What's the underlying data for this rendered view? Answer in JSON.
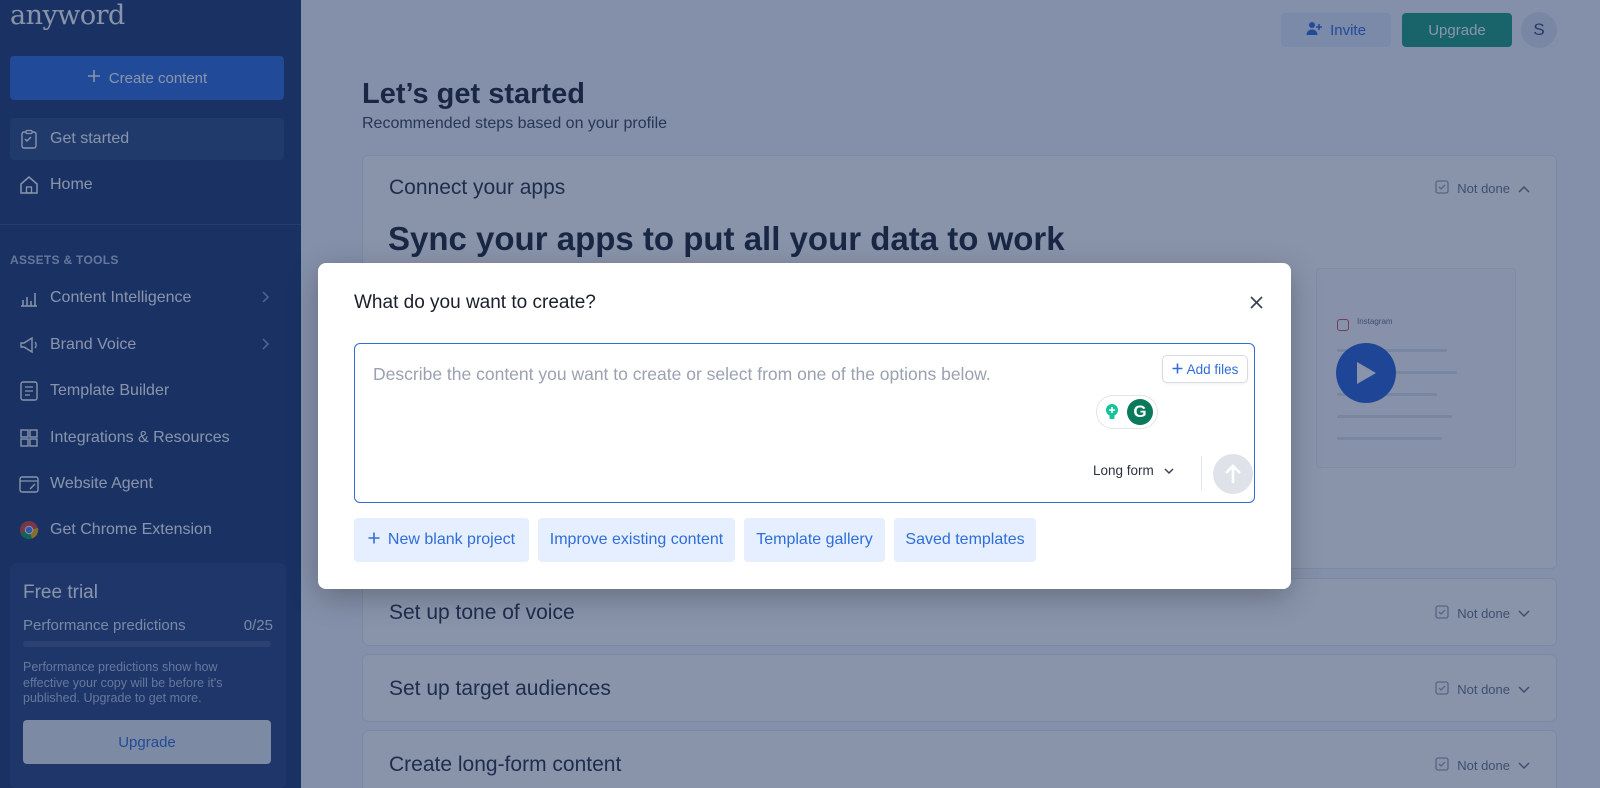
{
  "app": {
    "logo": "anyword"
  },
  "sidebar": {
    "create_label": "Create content",
    "items": [
      {
        "label": "Get started",
        "icon": "clipboard-icon"
      },
      {
        "label": "Home",
        "icon": "home-icon"
      }
    ],
    "section_title": "ASSETS & TOOLS",
    "tools": [
      {
        "label": "Content Intelligence",
        "icon": "chart-icon"
      },
      {
        "label": "Brand Voice",
        "icon": "megaphone-icon"
      },
      {
        "label": "Template Builder",
        "icon": "template-icon"
      },
      {
        "label": "Integrations & Resources",
        "icon": "grid-icon"
      },
      {
        "label": "Website Agent",
        "icon": "browser-icon"
      },
      {
        "label": "Get Chrome Extension",
        "icon": "chrome-icon"
      }
    ],
    "trial": {
      "title": "Free trial",
      "metric_label": "Performance predictions",
      "metric_value": "0/25",
      "progress": 0,
      "description": "Performance predictions show how effective your copy will be before it's published. Upgrade to get more.",
      "upgrade_label": "Upgrade"
    }
  },
  "header": {
    "invite_label": "Invite",
    "upgrade_label": "Upgrade",
    "avatar_initial": "S"
  },
  "main": {
    "title": "Let’s get started",
    "subtitle": "Recommended steps based on your profile",
    "sections": [
      {
        "title": "Connect your apps",
        "status": "Not done",
        "expanded": true
      },
      {
        "title": "Set up tone of voice",
        "status": "Not done"
      },
      {
        "title": "Set up target audiences",
        "status": "Not done"
      },
      {
        "title": "Create long-form content",
        "status": "Not done"
      }
    ],
    "hero_heading": "Sync your apps to put all your data to work",
    "preview_label": "Instagram"
  },
  "modal": {
    "title": "What do you want to create?",
    "placeholder": "Describe the content you want to create or select from one of the options below.",
    "add_files_label": "Add files",
    "format": "Long form",
    "actions": [
      {
        "label": "New blank project"
      },
      {
        "label": "Improve existing content"
      },
      {
        "label": "Template gallery"
      },
      {
        "label": "Saved templates"
      }
    ]
  },
  "colors": {
    "sidebar_bg": "#1e3a6e",
    "accent": "#2f6dd9",
    "upgrade_green": "#1e9e7c",
    "overlay": "rgba(20,42,88,0.5)"
  }
}
